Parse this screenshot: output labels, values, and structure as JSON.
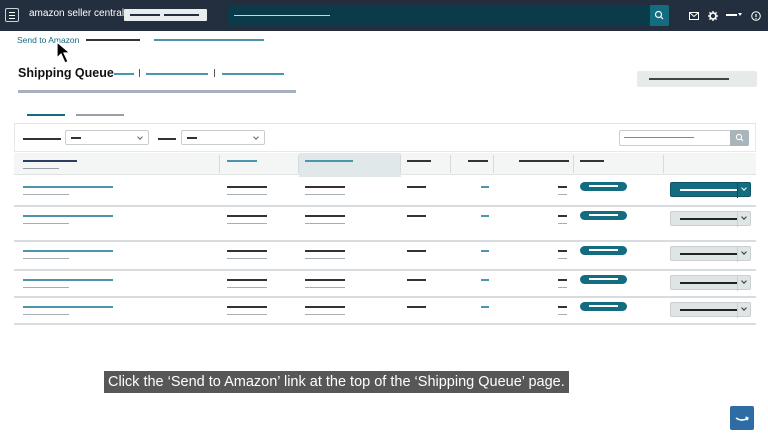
{
  "top_nav": {
    "logo_text": "amazon seller central",
    "icons": [
      "menu-icon",
      "search-icon",
      "mail-icon",
      "gear-icon",
      "globe-icon",
      "help-icon"
    ]
  },
  "breadcrumb": {
    "link": "Send to Amazon"
  },
  "page": {
    "title": "Shipping Queue"
  },
  "caption": "Click the ‘Send to Amazon’ link at the top of the ‘Shipping Queue’ page.",
  "colors": {
    "nav_bg": "#232f3e",
    "search_bg": "#0b3b4a",
    "accent": "#146c80",
    "link": "#146c80",
    "primary_button": "#146c80",
    "secondary_button": "#dfe4e5"
  },
  "table": {
    "column_count": 8,
    "sorted_column": 3,
    "row_count": 5,
    "rows": [
      {
        "primary_action": true
      },
      {
        "primary_action": false
      },
      {
        "primary_action": false
      },
      {
        "primary_action": false
      },
      {
        "primary_action": false
      }
    ]
  }
}
